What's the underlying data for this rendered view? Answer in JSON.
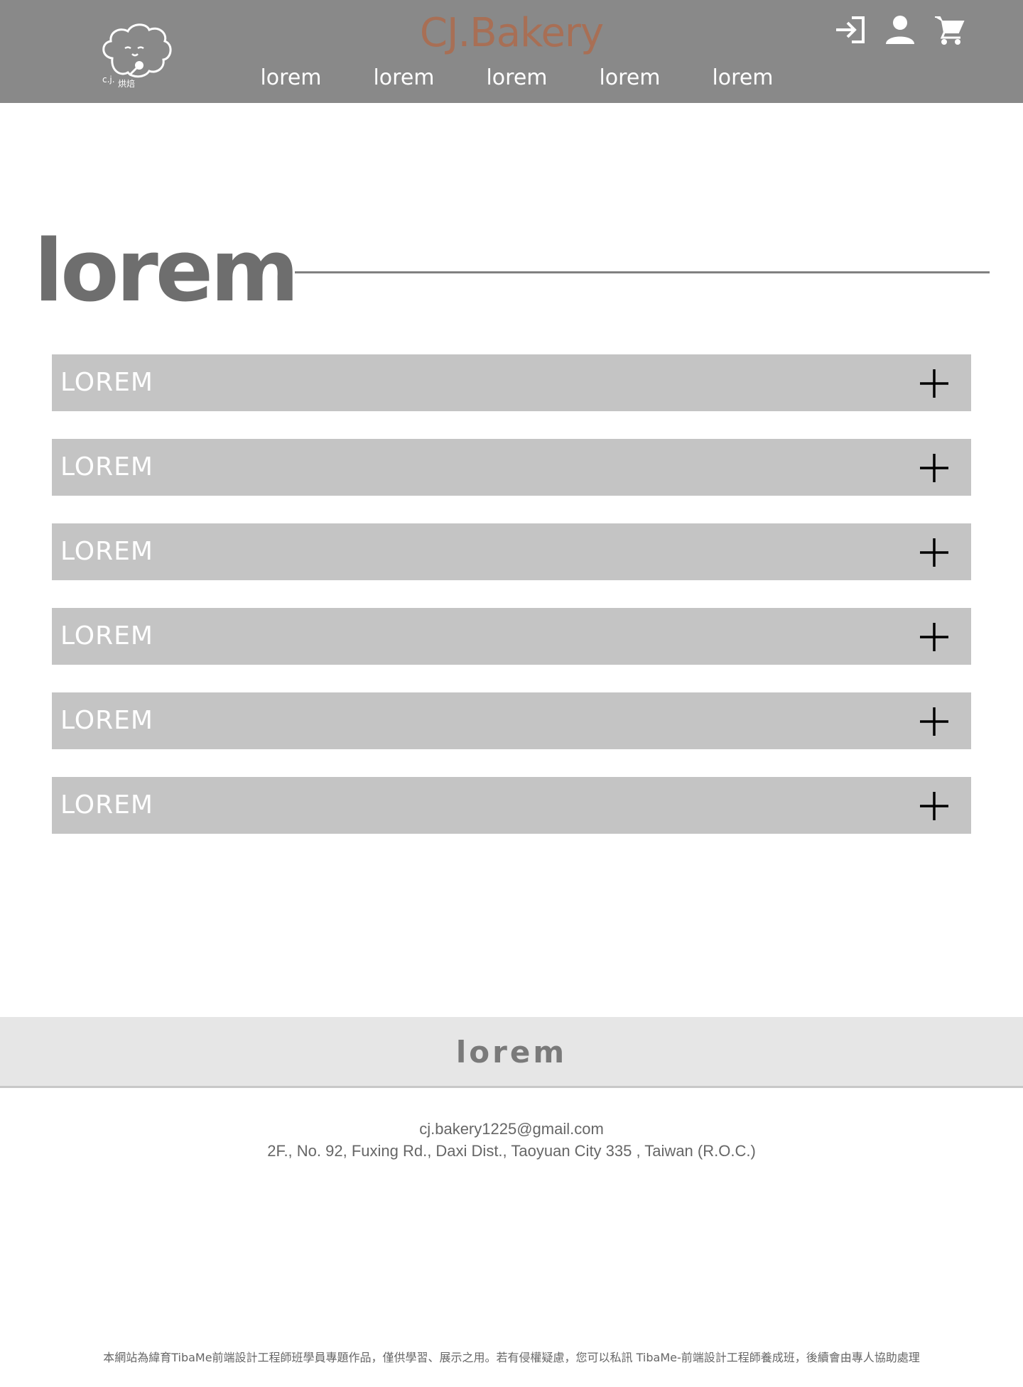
{
  "header": {
    "brand": "CJ.Bakery",
    "brand_color": "#a86f55",
    "background_color": "#898989",
    "logo_icon": "bakery-cloud-mascot-icon",
    "nav": [
      {
        "label": "lorem"
      },
      {
        "label": "lorem"
      },
      {
        "label": "lorem"
      },
      {
        "label": "lorem"
      },
      {
        "label": "lorem"
      }
    ],
    "icons": [
      "login-icon",
      "user-icon",
      "cart-icon"
    ]
  },
  "main": {
    "title": "lorem",
    "accordion": [
      {
        "label": "LOREM",
        "icon": "plus-icon"
      },
      {
        "label": "LOREM",
        "icon": "plus-icon"
      },
      {
        "label": "LOREM",
        "icon": "plus-icon"
      },
      {
        "label": "LOREM",
        "icon": "plus-icon"
      },
      {
        "label": "LOREM",
        "icon": "plus-icon"
      },
      {
        "label": "LOREM",
        "icon": "plus-icon"
      }
    ]
  },
  "footer": {
    "title": "lorem",
    "email": "cj.bakery1225@gmail.com",
    "address": "2F., No. 92, Fuxing Rd., Daxi Dist., Taoyuan City 335 , Taiwan (R.O.C.)",
    "disclaimer": "本網站為緯育TibaMe前端設計工程師班學員專題作品，僅供學習、展示之用。若有侵權疑慮，您可以私訊 TibaMe-前端設計工程師養成班，後續會由專人協助處理"
  }
}
